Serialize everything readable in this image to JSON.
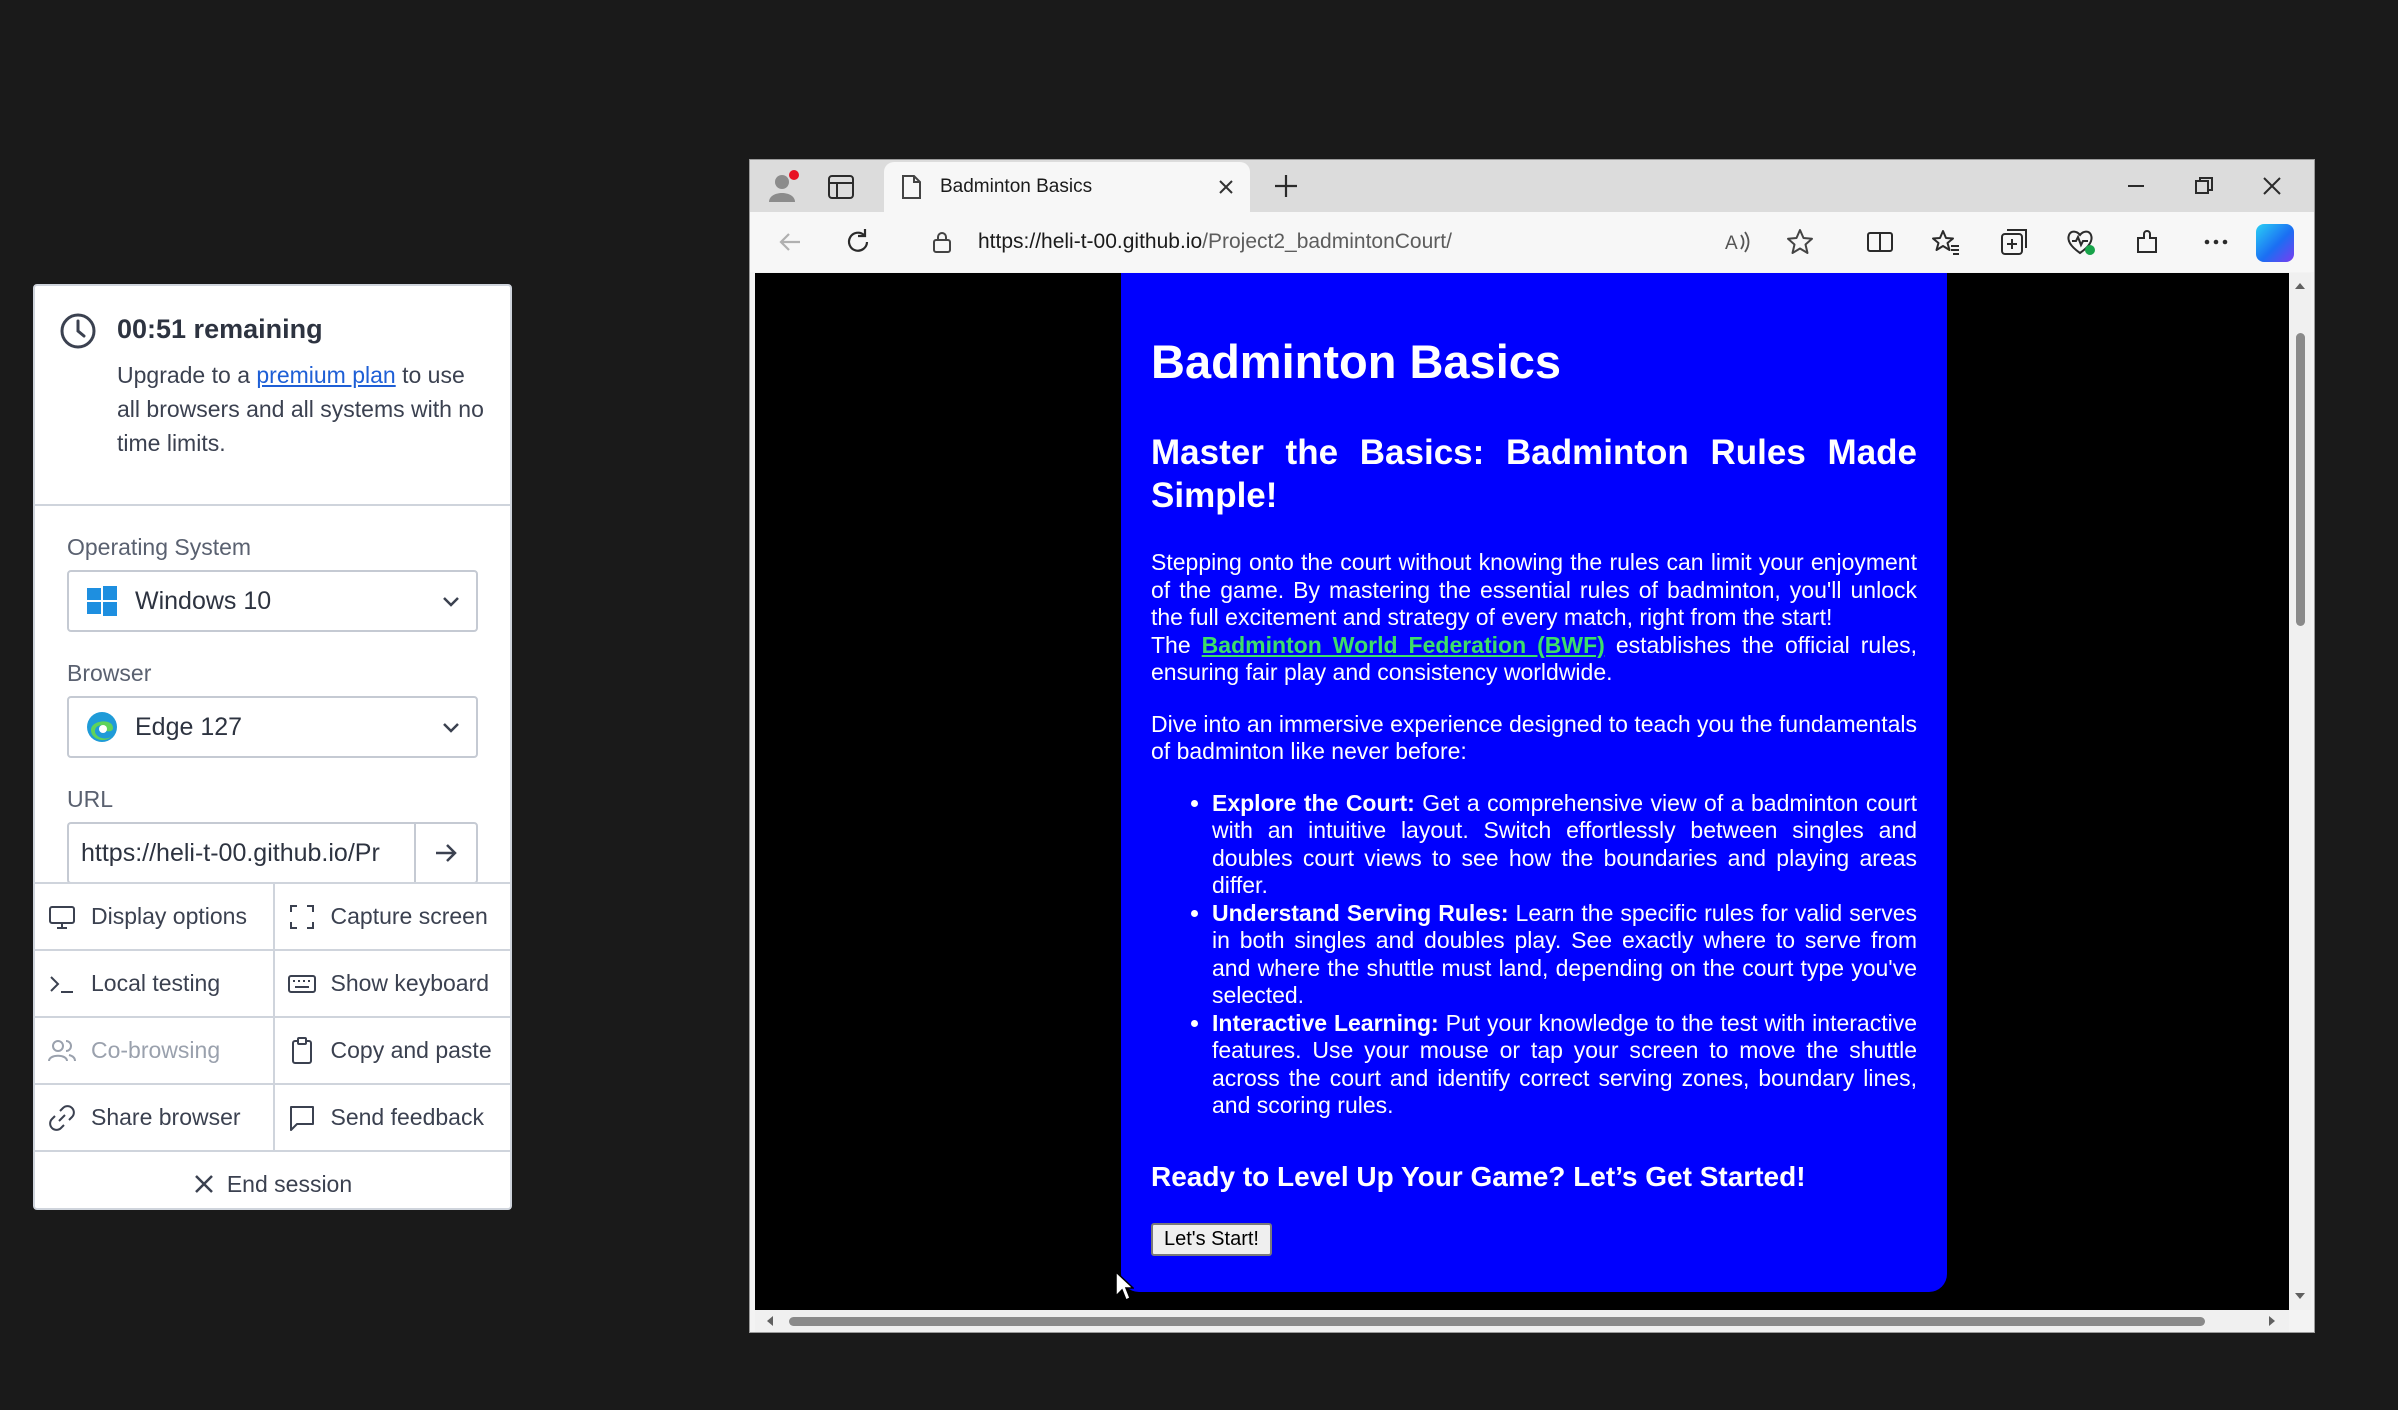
{
  "session": {
    "timer_title": "00:51 remaining",
    "upgrade_prefix": "Upgrade to a ",
    "upgrade_link": "premium plan",
    "upgrade_suffix": " to use all browsers and all systems with no time limits.",
    "os_label": "Operating System",
    "os_value": "Windows 10",
    "browser_label": "Browser",
    "browser_value": "Edge 127",
    "url_label": "URL",
    "url_value": "https://heli-t-00.github.io/Pr",
    "actions": {
      "display_options": "Display options",
      "capture_screen": "Capture screen",
      "local_testing": "Local testing",
      "show_keyboard": "Show keyboard",
      "co_browsing": "Co-browsing",
      "copy_and_paste": "Copy and paste",
      "share_browser": "Share browser",
      "send_feedback": "Send feedback",
      "end_session": "End session"
    }
  },
  "browser": {
    "tab_title": "Badminton Basics",
    "url_host": "https://heli-t-00.github.io",
    "url_path": "/Project2_badmintonCourt/"
  },
  "page": {
    "h1": "Badminton Basics",
    "h2": "Master the Basics: Badminton Rules Made Simple!",
    "intro": "Stepping onto the court without knowing the rules can limit your enjoyment of the game. By mastering the essential rules of badminton, you'll unlock the full excitement and strategy of every match, right from the start!",
    "bwf_prefix": "The ",
    "bwf_link": "Badminton World Federation (BWF)",
    "bwf_suffix": " establishes the official rules, ensuring fair play and consistency worldwide.",
    "dive": "Dive into an immersive experience designed to teach you the fundamentals of badminton like never before:",
    "features": [
      {
        "title": "Explore the Court:",
        "text": " Get a comprehensive view of a badminton court with an intuitive layout. Switch effortlessly between singles and doubles court views to see how the boundaries and playing areas differ."
      },
      {
        "title": "Understand Serving Rules:",
        "text": " Learn the specific rules for valid serves in both singles and doubles play. See exactly where to serve from and where the shuttle must land, depending on the court type you've selected."
      },
      {
        "title": "Interactive Learning:",
        "text": " Put your knowledge to the test with interactive features. Use your mouse or tap your screen to move the shuttle across the court and identify correct serving zones, boundary lines, and scoring rules."
      }
    ],
    "cta_heading": "Ready to Level Up Your Game? Let’s Get Started!",
    "start_button": "Let's Start!"
  },
  "colors": {
    "page_background": "#0000fe",
    "link_color": "#3dde6a",
    "panel_link": "#1e5fd6"
  }
}
